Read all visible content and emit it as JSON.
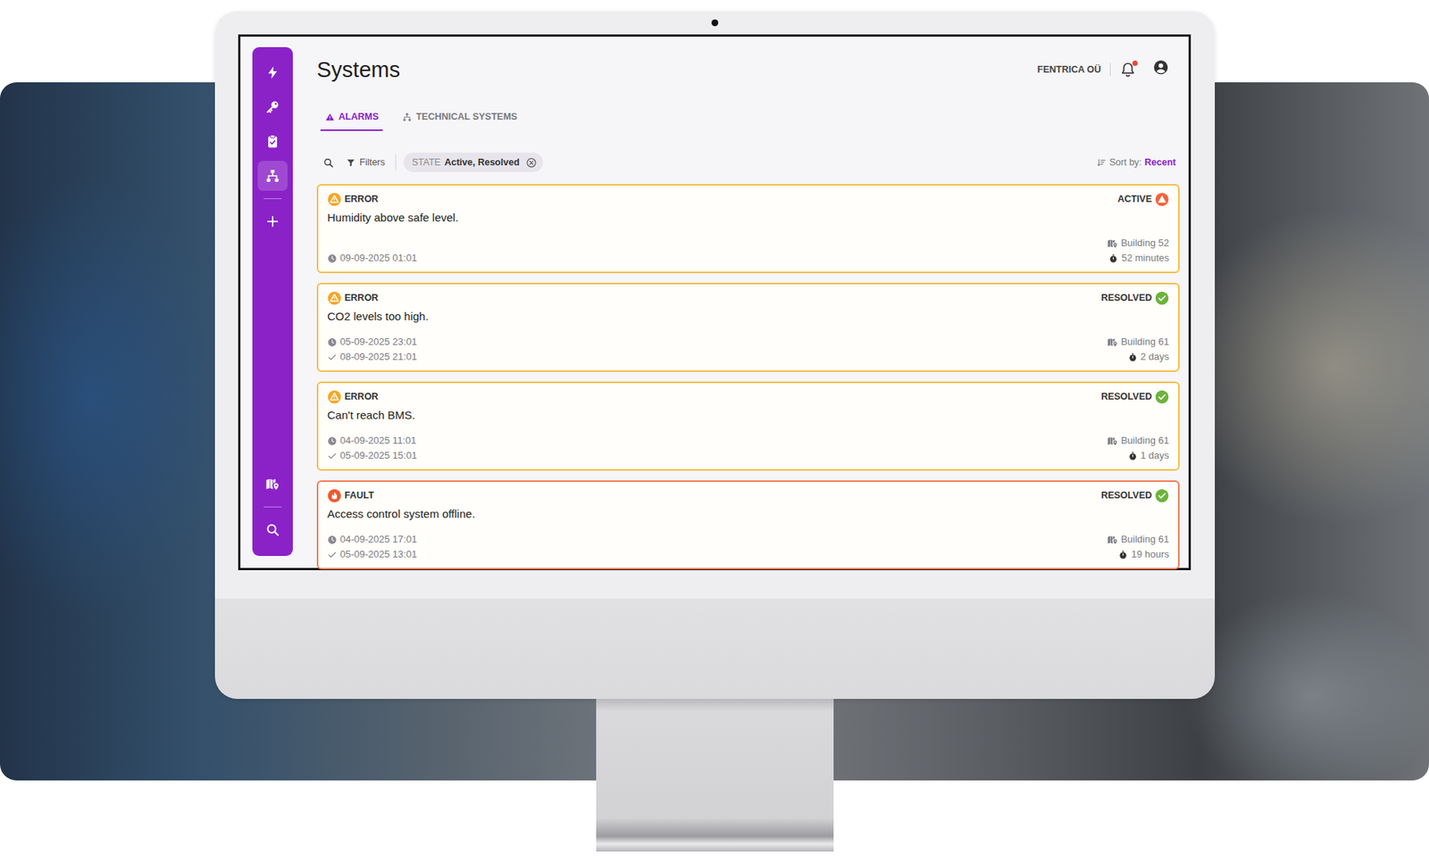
{
  "header": {
    "title": "Systems",
    "organization": "FENTRICA OÜ",
    "has_unread_notifications": true
  },
  "sidebar": {
    "top_items": [
      {
        "selected": false
      },
      {
        "selected": false
      },
      {
        "selected": false
      },
      {
        "selected": true
      }
    ],
    "bottom_items": [
      {
        "selected": false
      },
      {
        "selected": false
      }
    ]
  },
  "tabs": [
    {
      "label": "ALARMS",
      "selected": true
    },
    {
      "label": "TECHNICAL SYSTEMS",
      "selected": false
    }
  ],
  "toolbar": {
    "filters_label": "Filters",
    "chip": {
      "key": "STATE",
      "value": "Active, Resolved"
    },
    "sort_label": "Sort by:",
    "sort_value": "Recent"
  },
  "alarms": [
    {
      "kind": "error",
      "severity": "ERROR",
      "message": "Humidity above safe level.",
      "state": "ACTIVE",
      "resolved": false,
      "started": "09-09-2025 01:01",
      "location": "Building 52",
      "duration": "52 minutes"
    },
    {
      "kind": "error",
      "severity": "ERROR",
      "message": "CO2 levels too high.",
      "state": "RESOLVED",
      "resolved": true,
      "started": "05-09-2025 23:01",
      "ended": "08-09-2025 21:01",
      "location": "Building 61",
      "duration": "2 days"
    },
    {
      "kind": "error",
      "severity": "ERROR",
      "message": "Can't reach BMS.",
      "state": "RESOLVED",
      "resolved": true,
      "started": "04-09-2025 11:01",
      "ended": "05-09-2025 15:01",
      "location": "Building 61",
      "duration": "1 days"
    },
    {
      "kind": "fault",
      "severity": "FAULT",
      "message": "Access control system offline.",
      "state": "RESOLVED",
      "resolved": true,
      "started": "04-09-2025 17:01",
      "ended": "05-09-2025 13:01",
      "location": "Building 61",
      "duration": "19 hours"
    }
  ]
}
